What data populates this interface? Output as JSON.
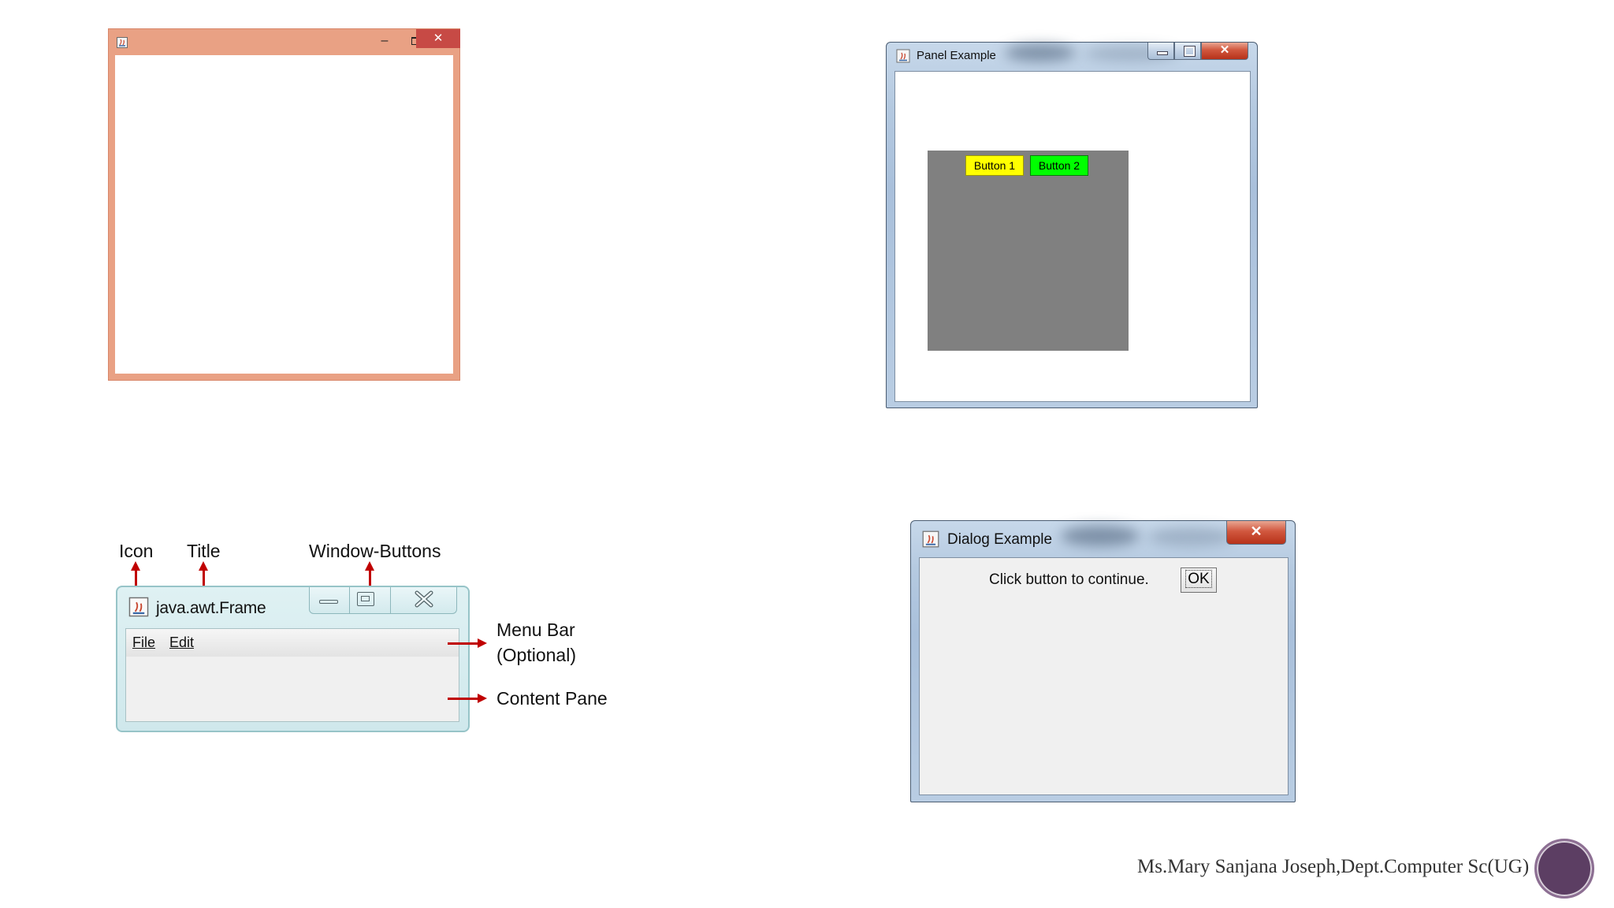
{
  "window1": {
    "title": "",
    "controls": {
      "minimize": "–",
      "maximize": "",
      "close": "✕"
    }
  },
  "panel_example": {
    "title": "Panel Example",
    "button1_label": "Button 1",
    "button2_label": "Button 2",
    "colors": {
      "panel": "#808080",
      "button1": "#ffff00",
      "button2": "#00ff00"
    }
  },
  "dialog_example": {
    "title": "Dialog Example",
    "message": "Click button to continue.",
    "ok_label": "OK",
    "close_symbol": "✕"
  },
  "frame_diagram": {
    "title": "java.awt.Frame",
    "menu": [
      "File",
      "Edit"
    ],
    "labels": {
      "icon": "Icon",
      "title": "Title",
      "window_buttons": "Window-Buttons",
      "menu_bar_line1": "Menu Bar",
      "menu_bar_line2": "(Optional)",
      "content_pane": "Content Pane"
    },
    "arrow_color": "#c00000"
  },
  "footer": {
    "text": "Ms.Mary Sanjana Joseph,Dept.Computer Sc(UG)"
  }
}
